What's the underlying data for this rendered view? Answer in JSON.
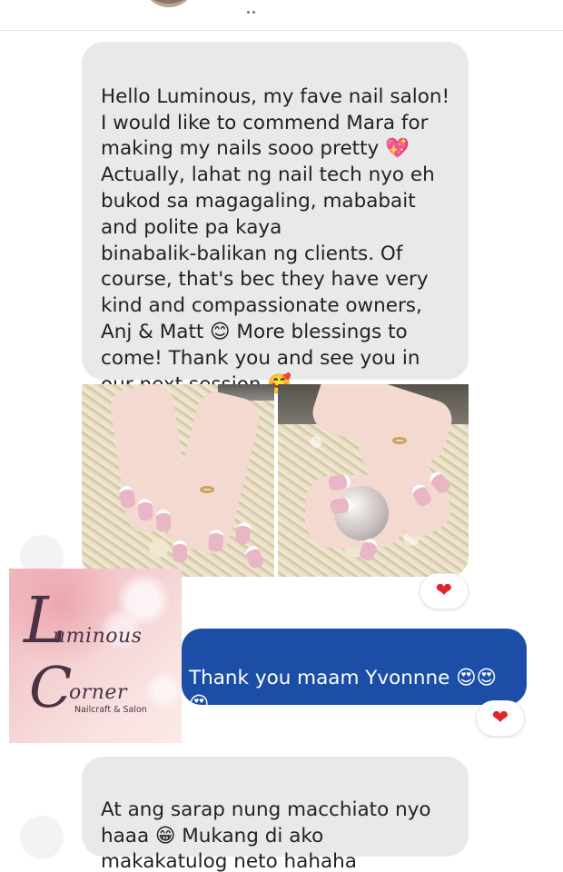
{
  "messages": {
    "first": {
      "text": "Hello Luminous, my fave nail salon!\nI would like to commend Mara for\nmaking my nails sooo pretty 💖\nActually, lahat ng nail tech nyo eh\nbukod sa magagaling, mababait\nand polite pa kaya\nbinabalik-balikan ng clients. Of\ncourse, that's bec they have very\nkind and compassionate owners,\nAnj & Matt 😊 More blessings to\ncome! Thank you and see you in\nour next session 🥰"
    },
    "reply": {
      "text": "Thank you maam Yvonnne 😍😍\n😍"
    },
    "last": {
      "text": "At ang sarap nung macchiato nyo\nhaaa 😁 Mukang di ako\nmakakatulog neto hahaha"
    }
  },
  "reactions": {
    "photos": "heart-icon",
    "reply": "heart-icon"
  },
  "logo": {
    "line1": "uminous",
    "big_l": "L",
    "line2": "orner",
    "big_c": "C",
    "subtitle": "Nailcraft & Salon"
  },
  "colors": {
    "incoming_bubble": "#e9e9e9",
    "outgoing_bubble": "#1c4ea7",
    "heart": "#e0242f"
  }
}
